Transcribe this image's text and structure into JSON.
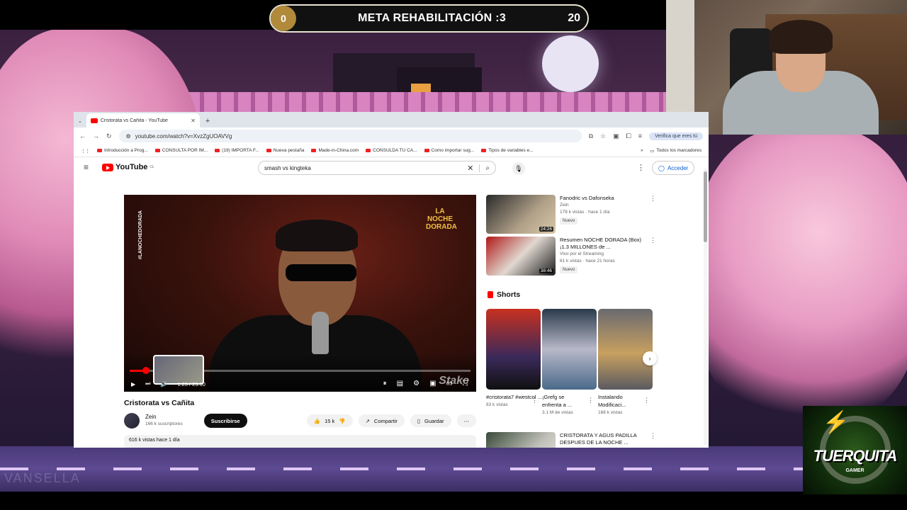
{
  "overlay": {
    "goal": {
      "current": "0",
      "title": "META REHABILITACIÓN :3",
      "target": "20"
    },
    "brand": {
      "name": "TUERQUITA",
      "sub": "GAMER"
    },
    "ghost_text": "VANSELLA"
  },
  "browser": {
    "tab_title": "Cristorata vs Cañita - YouTube",
    "url": "youtube.com/watch?v=XvzZgUOAVVg",
    "verify_label": "Verifica que eres tú",
    "bookmarks": [
      "Introducción a Prog...",
      "CONSULTA POR IM...",
      "(19) IMPORTA F...",
      "Nueva pestaña",
      "Made-in-China.com",
      "CONSULDA TU CA...",
      "Como importar sug...",
      "Tipos de variables e..."
    ],
    "all_bookmarks": "Todos los marcadores"
  },
  "youtube": {
    "logo_text": "YouTube",
    "logo_region": "CL",
    "search_value": "smash vs kingteka",
    "sign_in": "Acceder",
    "player": {
      "vertical_tag": "#LANOCHEDORADA",
      "brand_tag": "LA NOCHE DORADA",
      "time": "1:23 / 29:10",
      "watermark": "Stake",
      "progress": 0.048
    },
    "video": {
      "title": "Cristorata vs Cañita",
      "channel": "Zein",
      "subscribers": "166 k suscriptores",
      "subscribe": "Suscribirse",
      "likes": "15 k",
      "share": "Compartir",
      "save": "Guardar",
      "views_date": "616 k vistas  hace 1 día"
    },
    "recommended": [
      {
        "title": "Fanodric vs Dafonseka",
        "channel": "Zein",
        "meta": "178 k vistas · hace 1 día",
        "badge": "Nuevo",
        "duration": "24:26"
      },
      {
        "title": "Resumen NOCHE DORADA (Box) ¡1.3 MILLONES de ...",
        "channel": "Vivo por el Streaming",
        "meta": "61 k vistas · hace 21 horas",
        "badge": "Nuevo",
        "duration": "38:46"
      }
    ],
    "shorts_heading": "Shorts",
    "shorts": [
      {
        "caption": "#cristorata7 #westcol ...",
        "views": "83 k vistas"
      },
      {
        "caption": "¡Grefg se enfrenta a ...",
        "views": "3.1 M de vistas"
      },
      {
        "caption": "Instalando Modificaci...",
        "views": "168 k vistas"
      }
    ],
    "third_rec": {
      "title": "CRISTORATA Y AGUS PADILLA DESPUES DE LA NOCHE ..."
    }
  }
}
